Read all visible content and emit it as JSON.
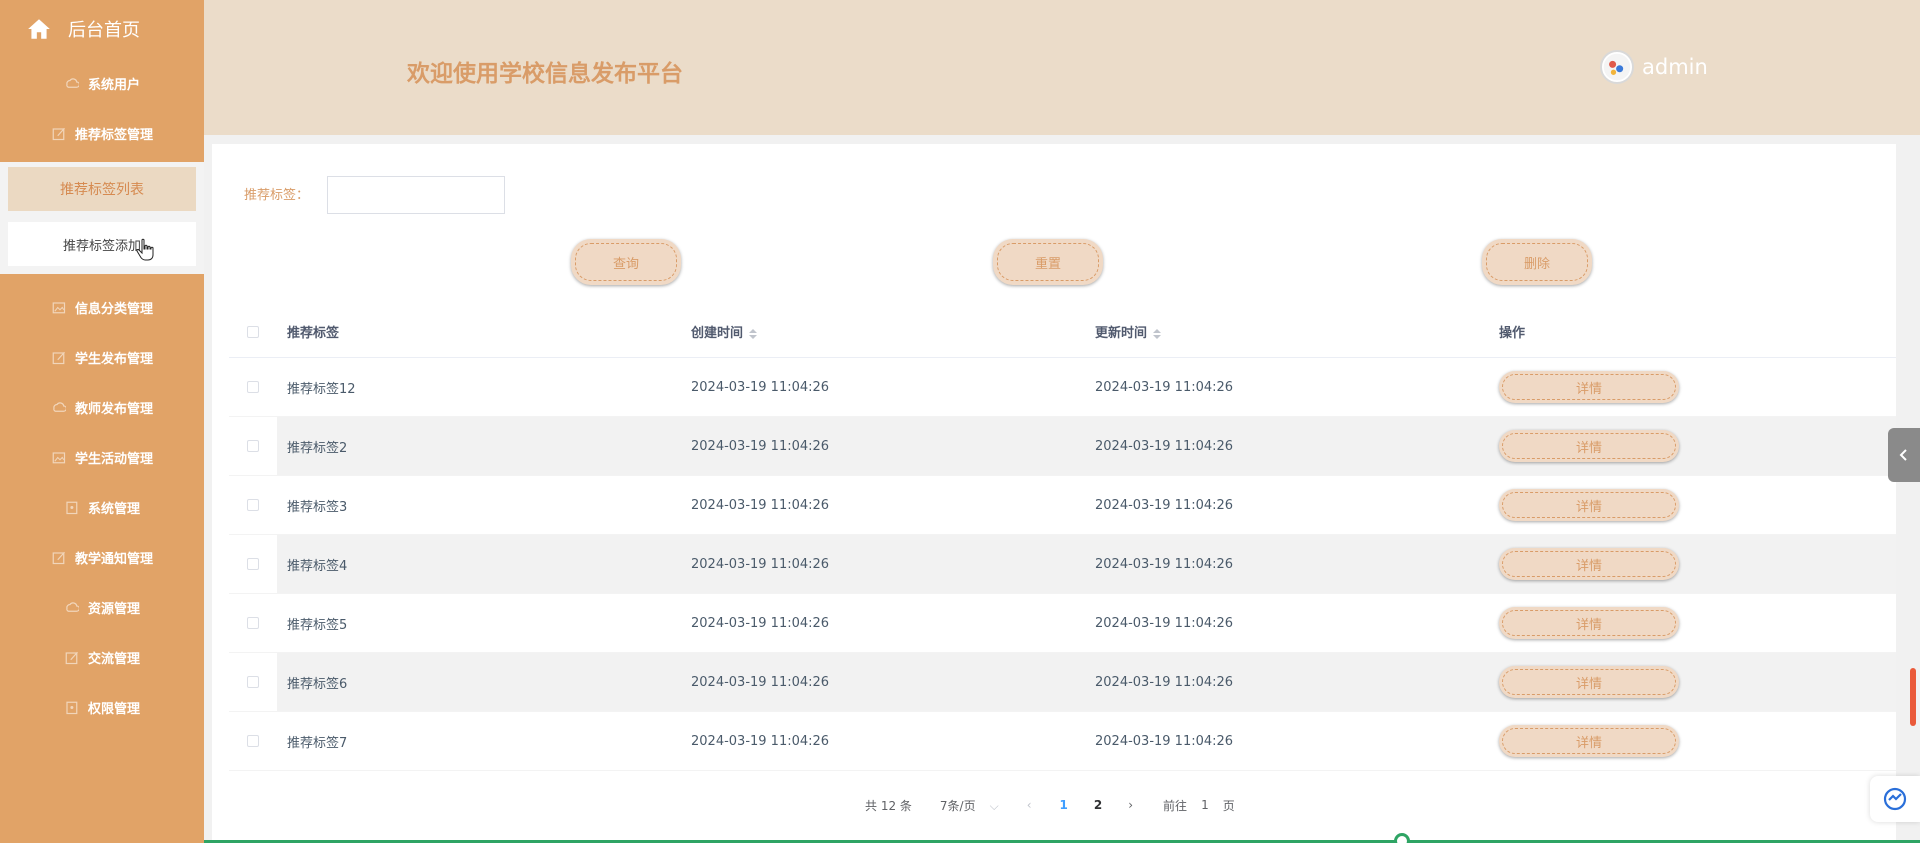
{
  "sidebar": {
    "home_label": "后台首页",
    "items": [
      {
        "label": "系统用户",
        "icon": "cloud-icon"
      },
      {
        "label": "推荐标签管理",
        "icon": "edit-icon"
      }
    ],
    "submenu": {
      "active_label": "推荐标签列表",
      "add_label": "推荐标签添加"
    },
    "items_after": [
      {
        "label": "信息分类管理",
        "icon": "image-icon"
      },
      {
        "label": "学生发布管理",
        "icon": "edit-icon"
      },
      {
        "label": "教师发布管理",
        "icon": "cloud-icon"
      },
      {
        "label": "学生活动管理",
        "icon": "image-icon"
      },
      {
        "label": "系统管理",
        "icon": "shield-icon"
      },
      {
        "label": "教学通知管理",
        "icon": "edit-icon"
      },
      {
        "label": "资源管理",
        "icon": "cloud-icon"
      },
      {
        "label": "交流管理",
        "icon": "edit-icon"
      },
      {
        "label": "权限管理",
        "icon": "shield-icon"
      }
    ]
  },
  "header": {
    "title": "欢迎使用学校信息发布平台",
    "username": "admin"
  },
  "search": {
    "label": "推荐标签：",
    "value": "",
    "placeholder": ""
  },
  "buttons": {
    "query": "查询",
    "reset": "重置",
    "delete": "删除"
  },
  "table": {
    "headers": {
      "tag": "推荐标签",
      "created": "创建时间",
      "updated": "更新时间",
      "actions": "操作"
    },
    "detail_label": "详情",
    "rows": [
      {
        "tag": "推荐标签12",
        "created": "2024-03-19 11:04:26",
        "updated": "2024-03-19 11:04:26"
      },
      {
        "tag": "推荐标签2",
        "created": "2024-03-19 11:04:26",
        "updated": "2024-03-19 11:04:26"
      },
      {
        "tag": "推荐标签3",
        "created": "2024-03-19 11:04:26",
        "updated": "2024-03-19 11:04:26"
      },
      {
        "tag": "推荐标签4",
        "created": "2024-03-19 11:04:26",
        "updated": "2024-03-19 11:04:26"
      },
      {
        "tag": "推荐标签5",
        "created": "2024-03-19 11:04:26",
        "updated": "2024-03-19 11:04:26"
      },
      {
        "tag": "推荐标签6",
        "created": "2024-03-19 11:04:26",
        "updated": "2024-03-19 11:04:26"
      },
      {
        "tag": "推荐标签7",
        "created": "2024-03-19 11:04:26",
        "updated": "2024-03-19 11:04:26"
      }
    ]
  },
  "pagination": {
    "total": "共 12 条",
    "page_size": "7条/页",
    "pages": [
      "1",
      "2"
    ],
    "current_page": "1",
    "goto_label": "前往",
    "goto_value": "1",
    "page_suffix": "页"
  },
  "colors": {
    "sidebar_bg": "#e1a367",
    "header_bg": "#ebdcc9",
    "accent": "#d99c68",
    "active_page": "#409eff"
  }
}
